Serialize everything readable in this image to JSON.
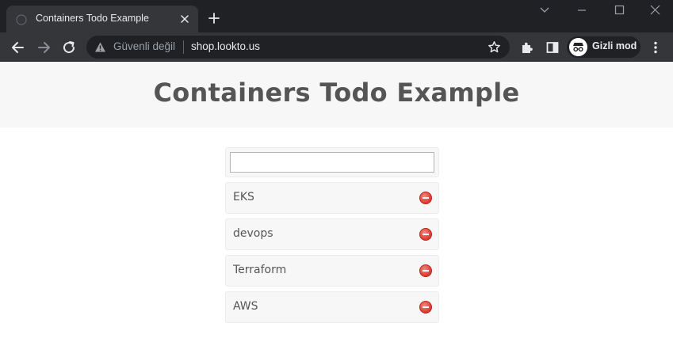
{
  "browser": {
    "tab_title": "Containers Todo Example",
    "omnibox": {
      "security_label": "Güvenli değil",
      "url": "shop.lookto.us"
    },
    "incognito_label": "Gizli mod"
  },
  "page": {
    "title": "Containers Todo Example",
    "input": {
      "value": "",
      "placeholder": ""
    },
    "items": [
      {
        "text": "EKS"
      },
      {
        "text": "devops"
      },
      {
        "text": "Terraform"
      },
      {
        "text": "AWS"
      }
    ]
  },
  "icons": {
    "tab": [
      "favicon",
      "close-icon",
      "plus-icon"
    ],
    "window": [
      "chevron-down-icon",
      "minimize-icon",
      "maximize-icon",
      "close-icon"
    ],
    "toolbar": [
      "back-icon",
      "forward-icon",
      "reload-icon",
      "warning-icon",
      "star-icon",
      "extensions-icon",
      "side-panel-icon",
      "incognito-icon",
      "menu-icon"
    ],
    "item": "remove-icon"
  },
  "colors": {
    "chrome_dark": "#202124",
    "chrome_toolbar": "#35363a",
    "header_bg": "#f7f7f7",
    "text": "#555555",
    "remove_red": "#e0443a"
  }
}
